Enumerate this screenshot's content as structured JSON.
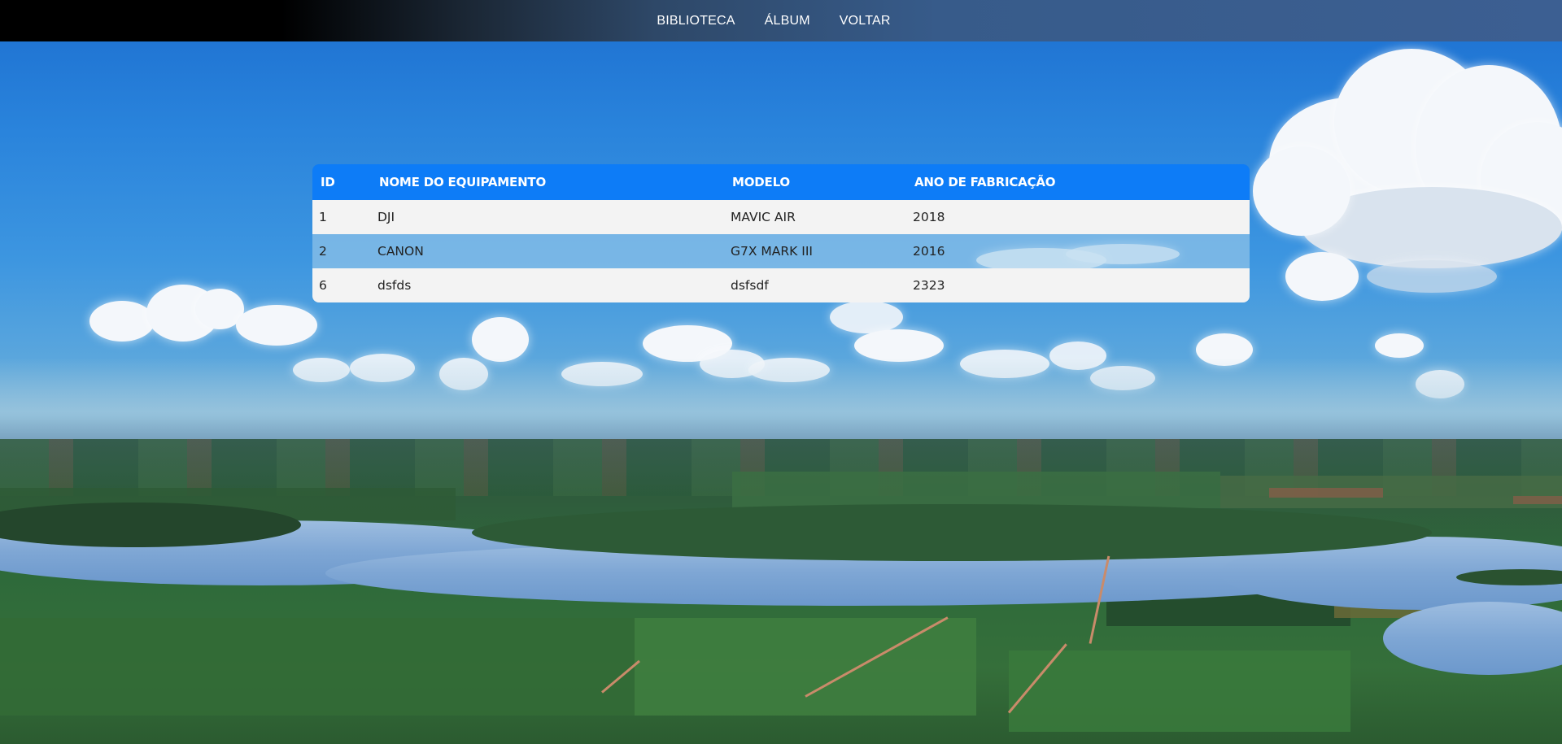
{
  "navbar": {
    "links": [
      "BIBLIOTECA",
      "ÁLBUM",
      "VOLTAR"
    ]
  },
  "table": {
    "headers": [
      "ID",
      "NOME DO EQUIPAMENTO",
      "MODELO",
      "ANO DE FABRICAÇÃO"
    ],
    "rows": [
      [
        "1",
        "DJI",
        "MAVIC AIR",
        "2018"
      ],
      [
        "2",
        "CANON",
        "G7X MARK III",
        "2016"
      ],
      [
        "6",
        "dsfds",
        "dsfsdf",
        "2323"
      ]
    ]
  },
  "colors": {
    "header_bg": "#0d7cf7",
    "row_light": "#f3f3f3",
    "nav_gradient_end": "#3c5f92"
  }
}
